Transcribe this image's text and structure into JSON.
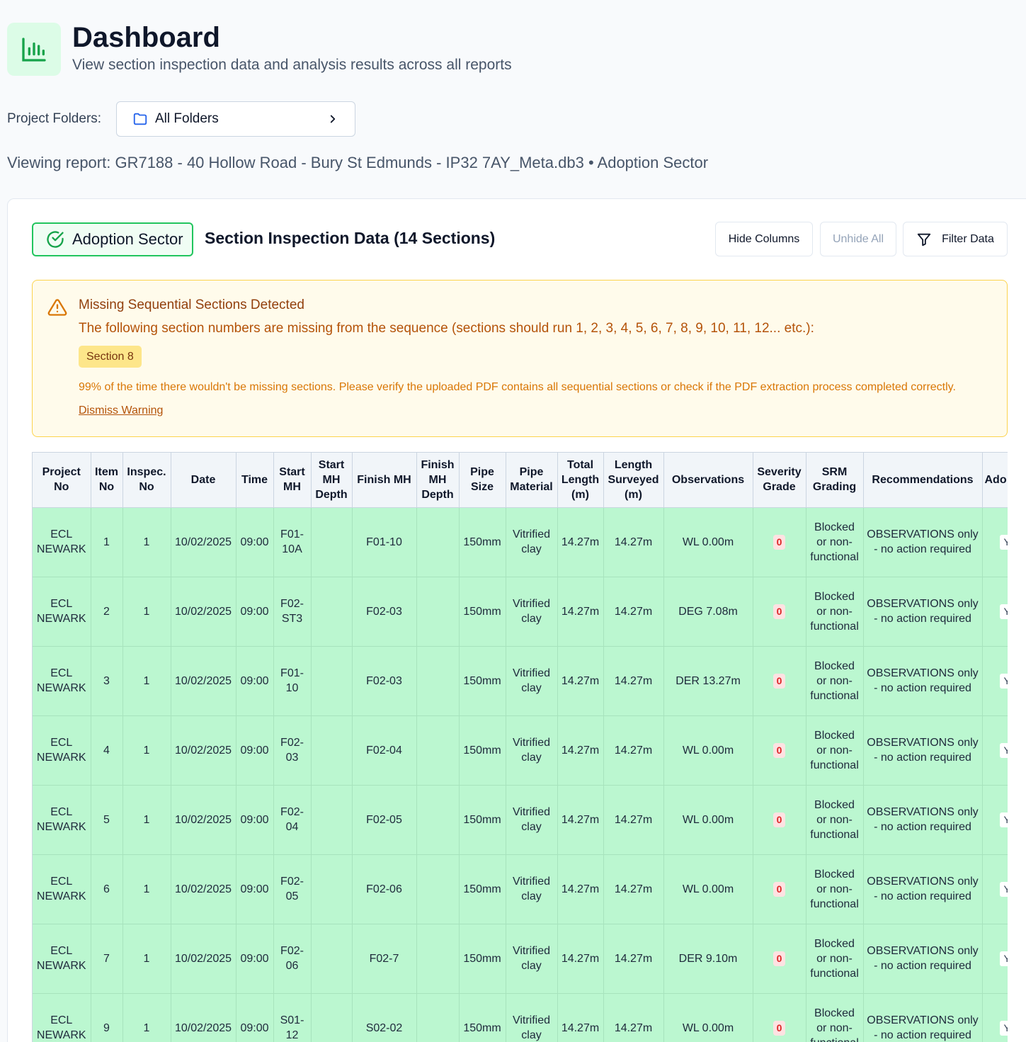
{
  "header": {
    "title": "Dashboard",
    "subtitle": "View section inspection data and analysis results across all reports"
  },
  "folders": {
    "label": "Project Folders:",
    "selected": "All Folders"
  },
  "viewing": "Viewing report: GR7188 - 40 Hollow Road - Bury St Edmunds - IP32 7AY_Meta.db3 • Adoption Sector",
  "card": {
    "sector_badge": "Adoption Sector",
    "section_title": "Section Inspection Data (14 Sections)",
    "buttons": {
      "hide_columns": "Hide Columns",
      "unhide_all": "Unhide All",
      "filter_data": "Filter Data"
    }
  },
  "warning": {
    "title": "Missing Sequential Sections Detected",
    "text": "The following section numbers are missing from the sequence (sections should run 1, 2, 3, 4, 5, 6, 7, 8, 9, 10, 11, 12... etc.):",
    "chip": "Section 8",
    "note": "99% of the time there wouldn't be missing sections. Please verify the uploaded PDF contains all sequential sections or check if the PDF extraction process completed correctly.",
    "dismiss": "Dismiss Warning"
  },
  "table": {
    "columns": [
      "Project No",
      "Item No",
      "Inspec. No",
      "Date",
      "Time",
      "Start MH",
      "Start MH Depth",
      "Finish MH",
      "Finish MH Depth",
      "Pipe Size",
      "Pipe Material",
      "Total Length (m)",
      "Length Surveyed (m)",
      "Observations",
      "Severity Grade",
      "SRM Grading",
      "Recommendations",
      "Ado"
    ],
    "rows": [
      [
        "ECL NEWARK",
        "1",
        "1",
        "10/02/2025",
        "09:00",
        "F01-10A",
        "",
        "F01-10",
        "",
        "150mm",
        "Vitrified clay",
        "14.27m",
        "14.27m",
        "WL 0.00m",
        "0",
        "Blocked or non-functional",
        "OBSERVATIONS only - no action required",
        "Y"
      ],
      [
        "ECL NEWARK",
        "2",
        "1",
        "10/02/2025",
        "09:00",
        "F02-ST3",
        "",
        "F02-03",
        "",
        "150mm",
        "Vitrified clay",
        "14.27m",
        "14.27m",
        "DEG 7.08m",
        "0",
        "Blocked or non-functional",
        "OBSERVATIONS only - no action required",
        "Y"
      ],
      [
        "ECL NEWARK",
        "3",
        "1",
        "10/02/2025",
        "09:00",
        "F01-10",
        "",
        "F02-03",
        "",
        "150mm",
        "Vitrified clay",
        "14.27m",
        "14.27m",
        "DER 13.27m",
        "0",
        "Blocked or non-functional",
        "OBSERVATIONS only - no action required",
        "Y"
      ],
      [
        "ECL NEWARK",
        "4",
        "1",
        "10/02/2025",
        "09:00",
        "F02-03",
        "",
        "F02-04",
        "",
        "150mm",
        "Vitrified clay",
        "14.27m",
        "14.27m",
        "WL 0.00m",
        "0",
        "Blocked or non-functional",
        "OBSERVATIONS only - no action required",
        "Y"
      ],
      [
        "ECL NEWARK",
        "5",
        "1",
        "10/02/2025",
        "09:00",
        "F02-04",
        "",
        "F02-05",
        "",
        "150mm",
        "Vitrified clay",
        "14.27m",
        "14.27m",
        "WL 0.00m",
        "0",
        "Blocked or non-functional",
        "OBSERVATIONS only - no action required",
        "Y"
      ],
      [
        "ECL NEWARK",
        "6",
        "1",
        "10/02/2025",
        "09:00",
        "F02-05",
        "",
        "F02-06",
        "",
        "150mm",
        "Vitrified clay",
        "14.27m",
        "14.27m",
        "WL 0.00m",
        "0",
        "Blocked or non-functional",
        "OBSERVATIONS only - no action required",
        "Y"
      ],
      [
        "ECL NEWARK",
        "7",
        "1",
        "10/02/2025",
        "09:00",
        "F02-06",
        "",
        "F02-7",
        "",
        "150mm",
        "Vitrified clay",
        "14.27m",
        "14.27m",
        "DER 9.10m",
        "0",
        "Blocked or non-functional",
        "OBSERVATIONS only - no action required",
        "Y"
      ],
      [
        "ECL NEWARK",
        "9",
        "1",
        "10/02/2025",
        "09:00",
        "S01-12",
        "",
        "S02-02",
        "",
        "150mm",
        "Vitrified clay",
        "14.27m",
        "14.27m",
        "WL 0.00m",
        "0",
        "Blocked or non-functional",
        "OBSERVATIONS only - no action required",
        "Y"
      ]
    ]
  },
  "colors": {
    "row_green": "#bbf7d0",
    "accent_green": "#22c55e",
    "warning_bg": "#fffbeb",
    "severity_red": "#dc2626"
  }
}
